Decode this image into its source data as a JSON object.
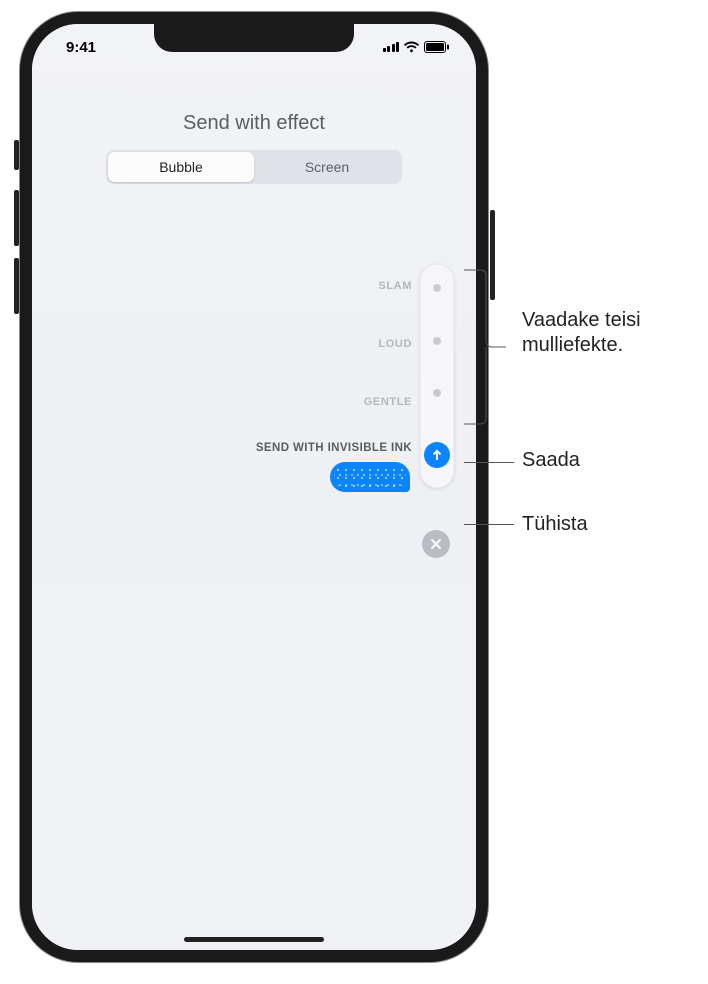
{
  "status": {
    "time": "9:41"
  },
  "header": {
    "title": "Send with effect"
  },
  "tabs": {
    "bubble": "Bubble",
    "screen": "Screen"
  },
  "effects": {
    "slam": "SLAM",
    "loud": "LOUD",
    "gentle": "GENTLE",
    "invisible_ink": "SEND WITH INVISIBLE INK"
  },
  "callouts": {
    "other_effects_line1": "Vaadake teisi",
    "other_effects_line2": "mulliefekte.",
    "send": "Saada",
    "cancel": "Tühista"
  }
}
